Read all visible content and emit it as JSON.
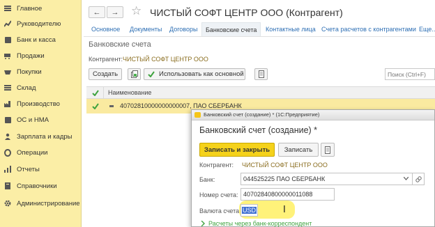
{
  "sidebar": {
    "items": [
      {
        "label": "Главное",
        "icon": "menu-icon"
      },
      {
        "label": "Руководителю",
        "icon": "chart-icon"
      },
      {
        "label": "Банк и касса",
        "icon": "bank-icon"
      },
      {
        "label": "Продажи",
        "icon": "cart-icon"
      },
      {
        "label": "Покупки",
        "icon": "basket-icon"
      },
      {
        "label": "Склад",
        "icon": "warehouse-icon"
      },
      {
        "label": "Производство",
        "icon": "factory-icon"
      },
      {
        "label": "ОС и НМА",
        "icon": "assets-icon"
      },
      {
        "label": "Зарплата и кадры",
        "icon": "people-icon"
      },
      {
        "label": "Операции",
        "icon": "operations-icon"
      },
      {
        "label": "Отчеты",
        "icon": "reports-icon"
      },
      {
        "label": "Справочники",
        "icon": "book-icon"
      },
      {
        "label": "Администрирование",
        "icon": "gear-icon"
      }
    ]
  },
  "header": {
    "back_symbol": "←",
    "forward_symbol": "→",
    "star_symbol": "☆",
    "title": "ЧИСТЫЙ СОФТ ЦЕНТР ООО (Контрагент)"
  },
  "tabs": [
    {
      "label": "Основное"
    },
    {
      "label": "Документы"
    },
    {
      "label": "Договоры"
    },
    {
      "label": "Банковские счета"
    },
    {
      "label": "Контактные лица"
    },
    {
      "label": "Счета расчетов с контрагентами"
    },
    {
      "label": "Еще..."
    }
  ],
  "section": {
    "title": "Банковские счета",
    "owner_label": "Контрагент:",
    "owner_value": "ЧИСТЫЙ СОФТ ЦЕНТР ООО"
  },
  "toolbar": {
    "create_label": "Создать",
    "use_main_label": "Использовать как основной",
    "search_placeholder": "Поиск (Ctrl+F)"
  },
  "table": {
    "column_header": "Наименование",
    "rows": [
      {
        "name": "40702810000000000007, ПАО СБЕРБАНК"
      }
    ]
  },
  "dialog": {
    "window_title": "Банковский счет (создание) * (1С:Предприятие)",
    "heading": "Банковский счет (создание) *",
    "save_close_label": "Записать и закрыть",
    "save_label": "Записать",
    "owner_label": "Контрагент:",
    "owner_value": "ЧИСТЫЙ СОФТ ЦЕНТР ООО",
    "bank_label": "Банк:",
    "bank_value": "044525225 ПАО СБЕРБАНК",
    "account_label": "Номер счета:",
    "account_value": "40702840800000011088",
    "currency_label": "Валюта счета:",
    "currency_value": "USD",
    "correspondent_label": "Расчеты через банк-корреспондент"
  },
  "colors": {
    "sidebar_bg": "#fbeea6",
    "accent_yellow": "#f5d21b",
    "link_blue": "#2e6fb4",
    "highlight": "#fff27a",
    "green": "#3fa33f"
  }
}
